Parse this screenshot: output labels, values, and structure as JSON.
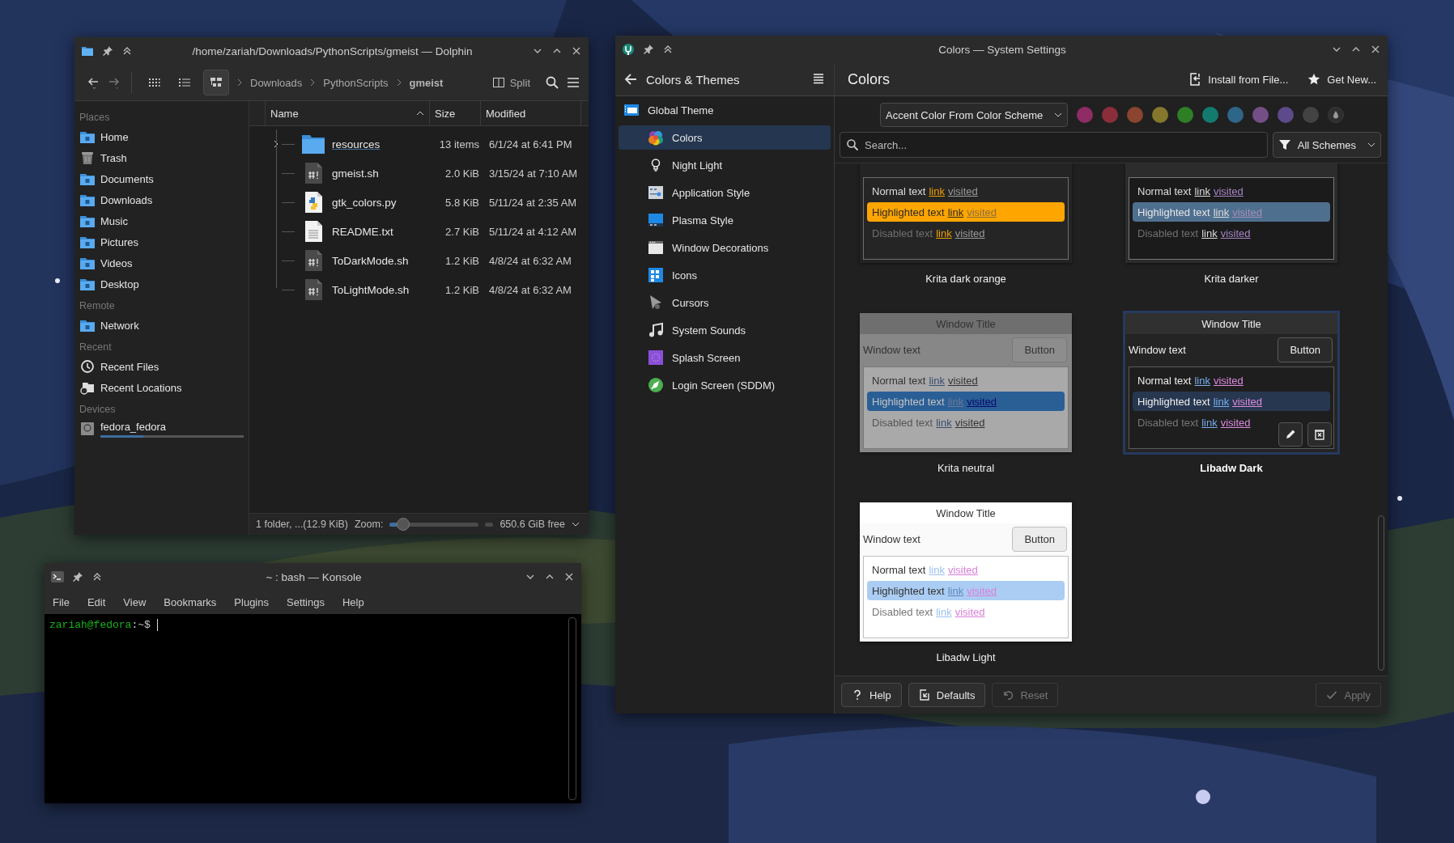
{
  "dolphin": {
    "title": "/home/zariah/Downloads/PythonScripts/gmeist — Dolphin",
    "view_modes": [
      {
        "kind": "icons",
        "selected": false
      },
      {
        "kind": "compact",
        "selected": false
      },
      {
        "kind": "details",
        "selected": true
      }
    ],
    "breadcrumbs": [
      {
        "label": "Downloads",
        "selected": false
      },
      {
        "label": "PythonScripts",
        "selected": false
      },
      {
        "label": "gmeist",
        "selected": true
      }
    ],
    "split_label": "Split",
    "places": [
      {
        "heading": "Places",
        "items": [
          {
            "label": "Home",
            "kind": "folder"
          },
          {
            "label": "Trash",
            "kind": "trash"
          },
          {
            "label": "Documents",
            "kind": "folder"
          },
          {
            "label": "Downloads",
            "kind": "folder"
          },
          {
            "label": "Music",
            "kind": "folder"
          },
          {
            "label": "Pictures",
            "kind": "folder"
          },
          {
            "label": "Videos",
            "kind": "folder"
          },
          {
            "label": "Desktop",
            "kind": "folder"
          }
        ]
      },
      {
        "heading": "Remote",
        "items": [
          {
            "label": "Network",
            "kind": "folder"
          }
        ]
      },
      {
        "heading": "Recent",
        "items": [
          {
            "label": "Recent Files",
            "kind": "clock"
          },
          {
            "label": "Recent Locations",
            "kind": "locations"
          }
        ]
      },
      {
        "heading": "Devices",
        "items": [
          {
            "label": "fedora_fedora",
            "kind": "drive",
            "level": 0.3
          }
        ]
      }
    ],
    "columns": [
      "Name",
      "Size",
      "Modified"
    ],
    "files": [
      {
        "name": "resources",
        "kind": "folder",
        "size": "13 items",
        "modified": "6/1/24 at 6:41 PM",
        "expanded": false
      },
      {
        "name": "gmeist.sh",
        "kind": "script",
        "size": "2.0 KiB",
        "modified": "3/15/24 at 7:10 AM"
      },
      {
        "name": "gtk_colors.py",
        "kind": "python",
        "size": "5.8 KiB",
        "modified": "5/11/24 at 2:35 AM"
      },
      {
        "name": "README.txt",
        "kind": "text",
        "size": "2.7 KiB",
        "modified": "5/11/24 at 4:12 AM"
      },
      {
        "name": "ToDarkMode.sh",
        "kind": "script",
        "size": "1.2 KiB",
        "modified": "4/8/24 at 6:32 AM"
      },
      {
        "name": "ToLightMode.sh",
        "kind": "script",
        "size": "1.2 KiB",
        "modified": "4/8/24 at 6:32 AM"
      }
    ],
    "status": "1 folder, ...(12.9 KiB)",
    "zoom_label": "Zoom:",
    "zoom": {
      "level": 0.15
    },
    "free_space": "650.6 GiB free"
  },
  "konsole": {
    "title": "~ : bash — Konsole",
    "menu": [
      "File",
      "Edit",
      "View",
      "Bookmarks",
      "Plugins",
      "Settings",
      "Help"
    ],
    "prompt_user": "zariah@fedora",
    "prompt_path": ":~$"
  },
  "settings": {
    "title": "Colors — System Settings",
    "sidebar_title": "Colors & Themes",
    "nav": [
      {
        "label": "Global Theme",
        "kind": "theme",
        "selected": false,
        "children": [
          {
            "label": "Colors",
            "kind": "colors",
            "selected": true
          },
          {
            "label": "Night Light",
            "kind": "bulb",
            "selected": false
          },
          {
            "label": "Application Style",
            "kind": "appstyle",
            "selected": false
          },
          {
            "label": "Plasma Style",
            "kind": "plasma",
            "selected": false
          },
          {
            "label": "Window Decorations",
            "kind": "decorations",
            "selected": false
          },
          {
            "label": "Icons",
            "kind": "icons",
            "selected": false
          },
          {
            "label": "Cursors",
            "kind": "cursor",
            "selected": false
          },
          {
            "label": "System Sounds",
            "kind": "sound",
            "selected": false
          },
          {
            "label": "Splash Screen",
            "kind": "splash",
            "selected": false
          },
          {
            "label": "Login Screen (SDDM)",
            "kind": "login",
            "selected": false
          }
        ]
      }
    ],
    "page_title": "Colors",
    "actions": [
      {
        "label": "Install from File...",
        "kind": "install"
      },
      {
        "label": "Get New...",
        "kind": "star"
      }
    ],
    "accent_dropdown": "Accent Color From Color Scheme",
    "accents": [
      {
        "kind": "swatch",
        "color": "#8e2c64",
        "selected": false
      },
      {
        "kind": "swatch",
        "color": "#8a2e3c",
        "selected": false
      },
      {
        "kind": "swatch",
        "color": "#8a4430",
        "selected": false
      },
      {
        "kind": "swatch",
        "color": "#85782c",
        "selected": false
      },
      {
        "kind": "swatch",
        "color": "#2e7e26",
        "selected": false
      },
      {
        "kind": "swatch",
        "color": "#137a6e",
        "selected": false
      },
      {
        "kind": "swatch",
        "color": "#2e6688",
        "selected": false
      },
      {
        "kind": "swatch",
        "color": "#744f86",
        "selected": false
      },
      {
        "kind": "swatch",
        "color": "#5c4a8a",
        "selected": false
      },
      {
        "kind": "swatch",
        "color": "#434343",
        "selected": false
      },
      {
        "kind": "custom",
        "selected": false
      }
    ],
    "search": {
      "placeholder": "Search..."
    },
    "filter": "All Schemes",
    "schemes": [
      {
        "name": "Krita dark orange",
        "kind": "orange",
        "color": "#ffa500",
        "selected": false,
        "hovered": false,
        "lines": [
          {
            "kind": "normal",
            "text": "Normal text",
            "link": "link",
            "visited": "visited"
          },
          {
            "kind": "highlighted",
            "text": "Highlighted text",
            "link": "link",
            "visited": "visited"
          },
          {
            "kind": "disabled",
            "text": "Disabled text",
            "link": "link",
            "visited": "visited"
          }
        ]
      },
      {
        "name": "Krita darker",
        "kind": "darker",
        "color": "#4f6f8f",
        "selected": false,
        "hovered": false,
        "lines": [
          {
            "kind": "normal",
            "text": "Normal text",
            "link": "link",
            "visited": "visited"
          },
          {
            "kind": "highlighted",
            "text": "Highlighted text",
            "link": "link",
            "visited": "visited"
          },
          {
            "kind": "disabled",
            "text": "Disabled text",
            "link": "link",
            "visited": "visited"
          }
        ]
      },
      {
        "name": "Krita neutral",
        "kind": "neutral",
        "color": "#2a5f96",
        "selected": false,
        "hovered": false,
        "title": "Window Title",
        "window_text": "Window text",
        "button": "Button",
        "lines": [
          {
            "kind": "normal",
            "text": "Normal text",
            "link": "link",
            "visited": "visited"
          },
          {
            "kind": "highlighted",
            "text": "Highlighted text",
            "link": "link",
            "visited": "visited"
          },
          {
            "kind": "disabled",
            "text": "Disabled text",
            "link": "link",
            "visited": "visited"
          }
        ]
      },
      {
        "name": "Libadw Dark",
        "kind": "adwdark",
        "color": "#273750",
        "selected": true,
        "hovered": true,
        "title": "Window Title",
        "window_text": "Window text",
        "button": "Button",
        "lines": [
          {
            "kind": "normal",
            "text": "Normal text",
            "link": "link",
            "visited": "visited"
          },
          {
            "kind": "highlighted",
            "text": "Highlighted text",
            "link": "link",
            "visited": "visited"
          },
          {
            "kind": "disabled",
            "text": "Disabled text",
            "link": "link",
            "visited": "visited"
          }
        ]
      },
      {
        "name": "Libadw Light",
        "kind": "adwlight",
        "color": "#abcdf3",
        "selected": false,
        "hovered": false,
        "title": "Window Title",
        "window_text": "Window text",
        "button": "Button",
        "lines": [
          {
            "kind": "normal",
            "text": "Normal text",
            "link": "link",
            "visited": "visited"
          },
          {
            "kind": "highlighted",
            "text": "Highlighted text",
            "link": "link",
            "visited": "visited"
          },
          {
            "kind": "disabled",
            "text": "Disabled text",
            "link": "link",
            "visited": "visited"
          }
        ]
      }
    ],
    "footer": [
      {
        "label": "Help",
        "kind": "help",
        "disabled": false
      },
      {
        "label": "Defaults",
        "kind": "defaults",
        "disabled": false
      },
      {
        "label": "Reset",
        "kind": "reset",
        "disabled": true
      },
      {
        "label": "Apply",
        "kind": "apply",
        "disabled": true
      }
    ]
  }
}
